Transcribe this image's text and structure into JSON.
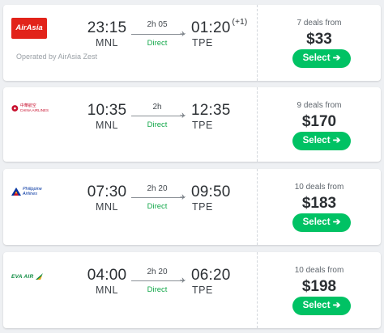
{
  "flights": [
    {
      "airline": "AirAsia",
      "logo_text": "AirAsia",
      "operated_by": "Operated by AirAsia Zest",
      "depart_time": "23:15",
      "depart_code": "MNL",
      "arrive_time": "01:20",
      "arrive_offset": "(+1)",
      "arrive_code": "TPE",
      "duration": "2h 05",
      "stops": "Direct",
      "deals": "7 deals from",
      "price": "$33",
      "select_label": "Select ➔"
    },
    {
      "airline": "China Airlines",
      "logo_text": "CHINA AIRLINES",
      "logo_text_small": "中華航空",
      "depart_time": "10:35",
      "depart_code": "MNL",
      "arrive_time": "12:35",
      "arrive_code": "TPE",
      "duration": "2h",
      "stops": "Direct",
      "deals": "9 deals from",
      "price": "$170",
      "select_label": "Select ➔"
    },
    {
      "airline": "Philippine Airlines",
      "logo_text": "Philippine Airlines",
      "depart_time": "07:30",
      "depart_code": "MNL",
      "arrive_time": "09:50",
      "arrive_code": "TPE",
      "duration": "2h 20",
      "stops": "Direct",
      "deals": "10 deals from",
      "price": "$183",
      "select_label": "Select ➔"
    },
    {
      "airline": "EVA Air",
      "logo_text": "EVA AIR",
      "depart_time": "04:00",
      "depart_code": "MNL",
      "arrive_time": "06:20",
      "arrive_code": "TPE",
      "duration": "2h 20",
      "stops": "Direct",
      "deals": "10 deals from",
      "price": "$198",
      "select_label": "Select ➔"
    }
  ],
  "icons": {
    "plane": "plane-icon",
    "arrow": "arrow-right-icon"
  },
  "colors": {
    "select_button": "#00c264",
    "direct_text": "#13a84a",
    "airasia_red": "#e2231a",
    "china_airlines_red": "#c8102e",
    "pal_blue": "#0033a0",
    "eva_green": "#0b8a3f"
  }
}
